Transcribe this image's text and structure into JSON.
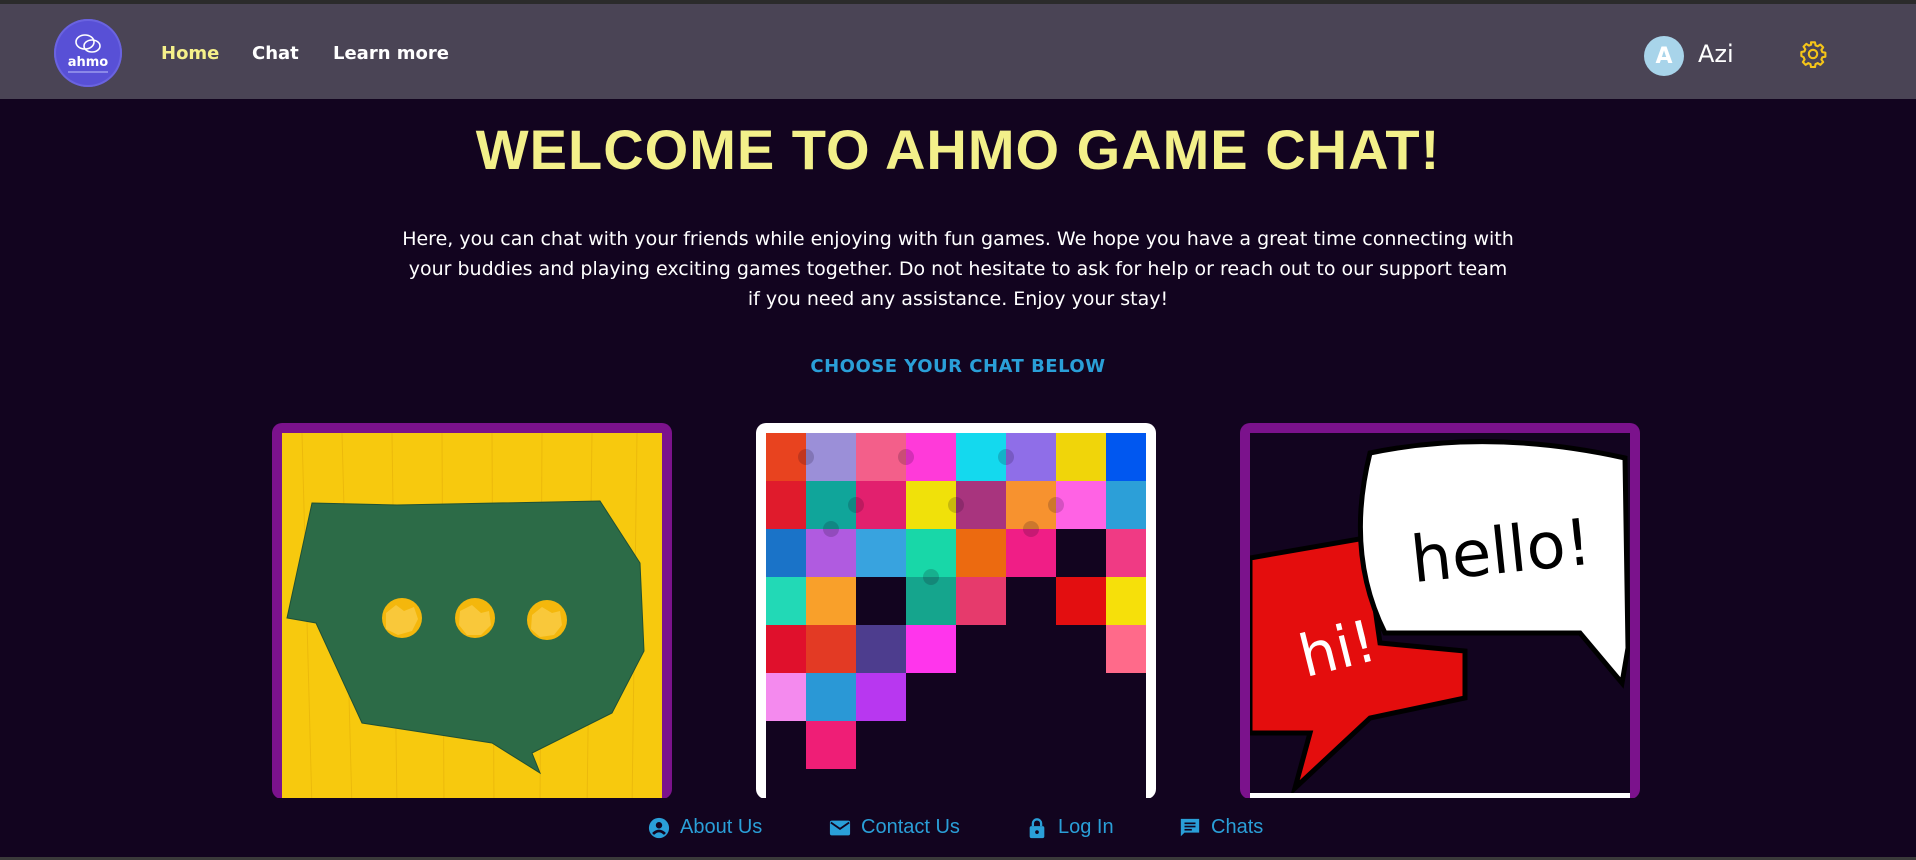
{
  "brand": {
    "logo_text": "ahmo"
  },
  "nav": {
    "home": "Home",
    "chat": "Chat",
    "learn_more": "Learn more"
  },
  "user": {
    "initial": "A",
    "name": "Azi"
  },
  "main": {
    "title": "WELCOME TO AHMO GAME CHAT!",
    "intro": "Here, you can chat with your friends while enjoying with fun games. We hope you have a great time connecting with your buddies and playing exciting games together. Do not hesitate to ask for help or reach out to our support team if you need any assistance. Enjoy your stay!",
    "choose_label": "CHOOSE YOUR CHAT BELOW",
    "cards": [
      {
        "image": "paper-balls-speech-bubble"
      },
      {
        "image": "colorful-puzzle-pieces"
      },
      {
        "image": "hi-hello-speech-bubbles",
        "bubble_text_1": "hi!",
        "bubble_text_2": "hello!"
      }
    ]
  },
  "footer": {
    "about": "About Us",
    "contact": "Contact Us",
    "login": "Log In",
    "chats": "Chats"
  },
  "colors": {
    "background": "#12041f",
    "navbar": "#4a4455",
    "accent_yellow": "#f3f08a",
    "accent_blue": "#2a9fd8",
    "card_border": "#7b128c"
  }
}
